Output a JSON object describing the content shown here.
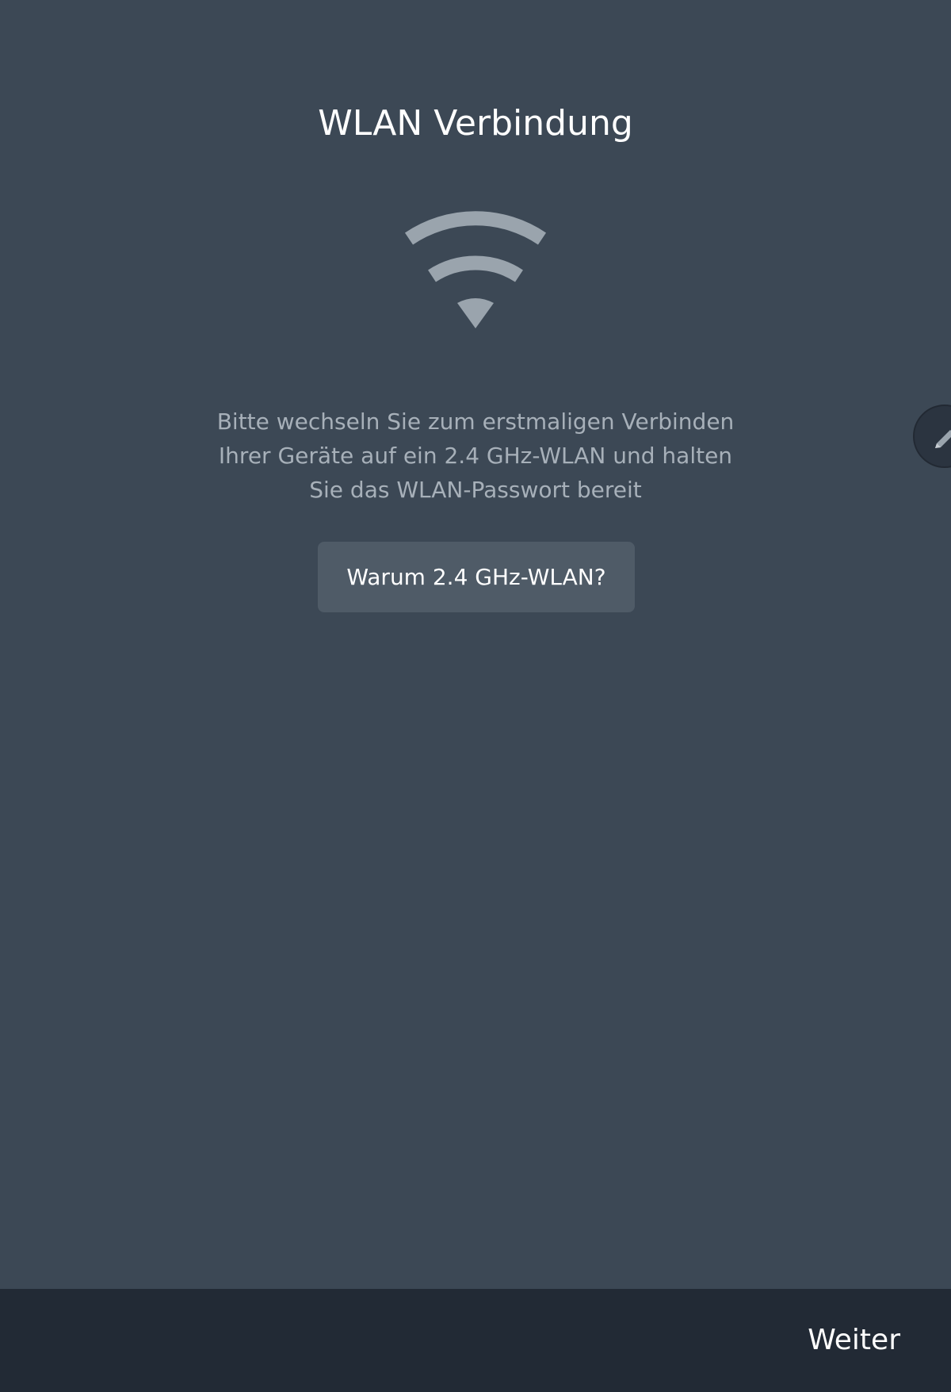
{
  "header": {
    "title": "WLAN Verbindung"
  },
  "main": {
    "icon": "wifi-icon",
    "description": "Bitte wechseln Sie zum erstmaligen Verbinden Ihrer Geräte auf ein 2.4 GHz-WLAN und halten Sie das WLAN-Passwort bereit",
    "info_button_label": "Warum 2.4 GHz-WLAN?"
  },
  "floating": {
    "icon": "pencil-icon"
  },
  "footer": {
    "next_label": "Weiter"
  },
  "colors": {
    "background": "#3c4855",
    "footer": "#222a35",
    "button": "#4f5b67",
    "icon": "#9aa4ad",
    "muted_text": "#a7b0b9"
  }
}
